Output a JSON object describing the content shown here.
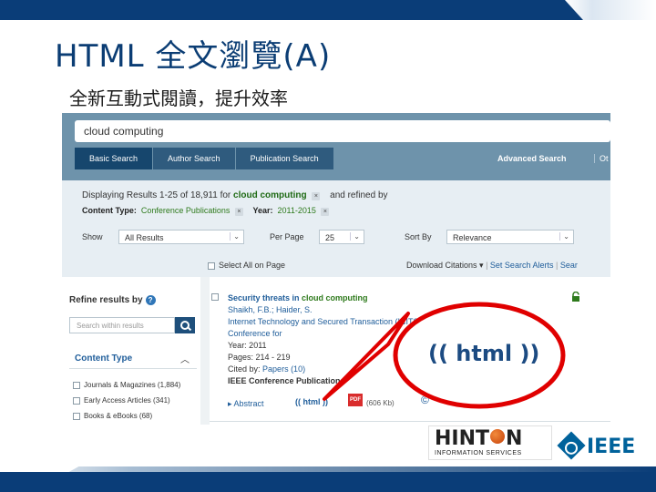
{
  "slide": {
    "title": "HTML 全文瀏覽(A)",
    "subtitle": "全新互動式閱讀，提升效率"
  },
  "search": {
    "query": "cloud computing",
    "tabs": [
      {
        "label": "Basic Search",
        "active": true
      },
      {
        "label": "Author Search",
        "active": false
      },
      {
        "label": "Publication Search",
        "active": false
      }
    ],
    "advanced_label": "Advanced Search",
    "other_label": "Ot"
  },
  "results": {
    "display_prefix": "Displaying Results 1-25 of 18,911 for",
    "display_query": "cloud computing",
    "display_suffix": "and refined by",
    "content_type_label": "Content Type:",
    "content_type_value": "Conference Publications",
    "year_label": "Year:",
    "year_value": "2011-2015",
    "remove_filter_symbol": "×",
    "show_label": "Show",
    "show_value": "All Results",
    "per_page_label": "Per Page",
    "per_page_value": "25",
    "sort_by_label": "Sort By",
    "sort_by_value": "Relevance",
    "select_all_label": "Select All on Page",
    "download_citations_label": "Download Citations ▾",
    "search_alerts_label": "Set Search Alerts",
    "search_history_label": "Sear"
  },
  "refine": {
    "title": "Refine results by",
    "help_symbol": "?",
    "within_placeholder": "Search within results",
    "content_type_heading": "Content Type",
    "collapse_symbol": "︿",
    "facets": [
      {
        "label": "Journals & Magazines (1,884)"
      },
      {
        "label": "Early Access Articles (341)"
      },
      {
        "label": "Books & eBooks (68)"
      }
    ]
  },
  "result_item": {
    "title_prefix": "Security threats in",
    "title_keyword": "cloud computing",
    "authors": "Shaikh, F.B.; Haider, S.",
    "conference_line1": "Internet Technology and Secured Transaction (ICITST), 2011 International",
    "conference_line2": "Conference for",
    "year_line": "Year: 2011",
    "pages_line": "Pages: 214 - 219",
    "cited_label": "Cited by:",
    "cited_value": "Papers (10)",
    "publisher_line": "IEEE Conference Publications",
    "abstract_label": "▸ Abstract",
    "html_label": "(( html ))",
    "pdf_label": "PDF",
    "pdf_size": "(606 Kb)",
    "rights_icon": "©"
  },
  "callout": {
    "label": "(( html ))",
    "color": "#e00000"
  },
  "logos": {
    "hinton_word_left": "HINT",
    "hinton_word_right": "N",
    "hinton_sub": "INFORMATION SERVICES",
    "ieee": "IEEE"
  },
  "colors": {
    "banner": "#0a3d78",
    "title": "#0b3d74",
    "search_band": "#6e93ab",
    "tab_active": "#16466d",
    "link_blue": "#1f5d9a",
    "keyword_green": "#2e7a1c"
  }
}
